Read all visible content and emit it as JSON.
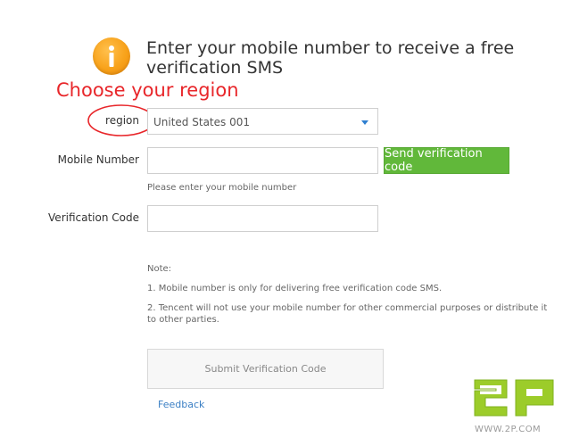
{
  "header": {
    "title": "Enter your mobile number to receive a free verification SMS",
    "icon": "info-icon",
    "icon_color": "#f8a21a"
  },
  "annotation": {
    "text": "Choose your region",
    "color": "#e8262a"
  },
  "form": {
    "region": {
      "label": "region",
      "selected_value": "United States 001"
    },
    "mobile": {
      "label": "Mobile Number",
      "value": "",
      "hint": "Please enter your mobile number"
    },
    "send_button": {
      "label": "Send verification code",
      "color": "#61b83a"
    },
    "verification": {
      "label": "Verification Code",
      "value": ""
    }
  },
  "notes": {
    "title": "Note:",
    "items": [
      "1. Mobile number is only for delivering free verification code SMS.",
      "2. Tencent will not use your mobile number for other commercial purposes or distribute it to other parties."
    ]
  },
  "submit_button": {
    "label": "Submit Verification Code"
  },
  "feedback_link": {
    "label": "Feedback",
    "color": "#3b7fc4"
  },
  "watermark": {
    "logo_text": "2P",
    "url_text": "WWW.2P.COM",
    "color": "#9ccc2a"
  }
}
